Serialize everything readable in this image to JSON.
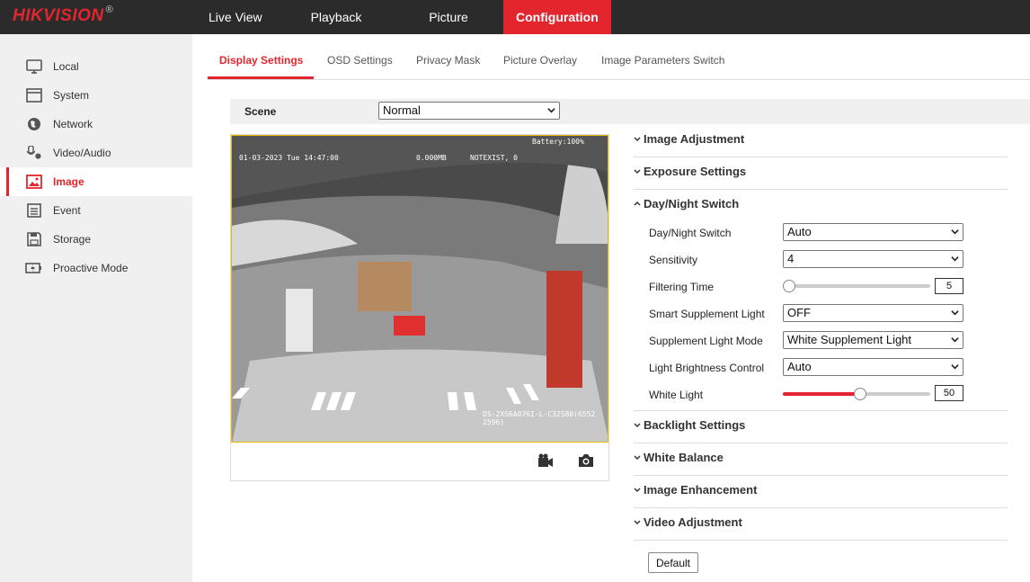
{
  "brand": {
    "logo": "HIKVISION",
    "reg_mark": "®"
  },
  "topnav": [
    "Live View",
    "Playback",
    "Picture",
    "Configuration"
  ],
  "sidebar": {
    "items": [
      {
        "label": "Local",
        "icon": "monitor-icon"
      },
      {
        "label": "System",
        "icon": "system-icon"
      },
      {
        "label": "Network",
        "icon": "globe-icon"
      },
      {
        "label": "Video/Audio",
        "icon": "mic-camera-icon"
      },
      {
        "label": "Image",
        "icon": "image-icon"
      },
      {
        "label": "Event",
        "icon": "calendar-icon"
      },
      {
        "label": "Storage",
        "icon": "save-icon"
      },
      {
        "label": "Proactive Mode",
        "icon": "battery-icon"
      }
    ],
    "active": "Image"
  },
  "tabs": [
    "Display Settings",
    "OSD Settings",
    "Privacy Mask",
    "Picture Overlay",
    "Image Parameters Switch"
  ],
  "scene": {
    "label": "Scene",
    "value": "Normal"
  },
  "video": {
    "osd_datetime": "01-03-2023 Tue 14:47:00",
    "osd_storage": "0.000MB",
    "osd_status": "NOTEXIST, 0",
    "osd_battery": "Battery:100%",
    "osd_model": "DS-2XS6A076I-L-C32S80(6552 2596)",
    "tools": [
      "record-icon",
      "capture-icon"
    ]
  },
  "sections": {
    "image_adjustment": "Image Adjustment",
    "exposure": "Exposure Settings",
    "daynight": "Day/Night Switch",
    "backlight": "Backlight Settings",
    "white_balance": "White Balance",
    "enhancement": "Image Enhancement",
    "video_adjustment": "Video Adjustment"
  },
  "daynight_fields": {
    "switch_label": "Day/Night Switch",
    "switch_value": "Auto",
    "sensitivity_label": "Sensitivity",
    "sensitivity_value": "4",
    "filtering_label": "Filtering Time",
    "filtering_value": "5",
    "smart_label": "Smart Supplement Light",
    "smart_value": "OFF",
    "mode_label": "Supplement Light Mode",
    "mode_value": "White Supplement Light",
    "brightness_label": "Light Brightness Control",
    "brightness_value": "Auto",
    "white_label": "White Light",
    "white_value": "50"
  },
  "slider_levels": {
    "filtering_fraction": 0.0,
    "white_fraction": 0.5
  },
  "default_button": "Default",
  "colors": {
    "accent": "#e3262e",
    "topbar": "#2b2b2b",
    "sidebar": "#f0f0f0"
  }
}
